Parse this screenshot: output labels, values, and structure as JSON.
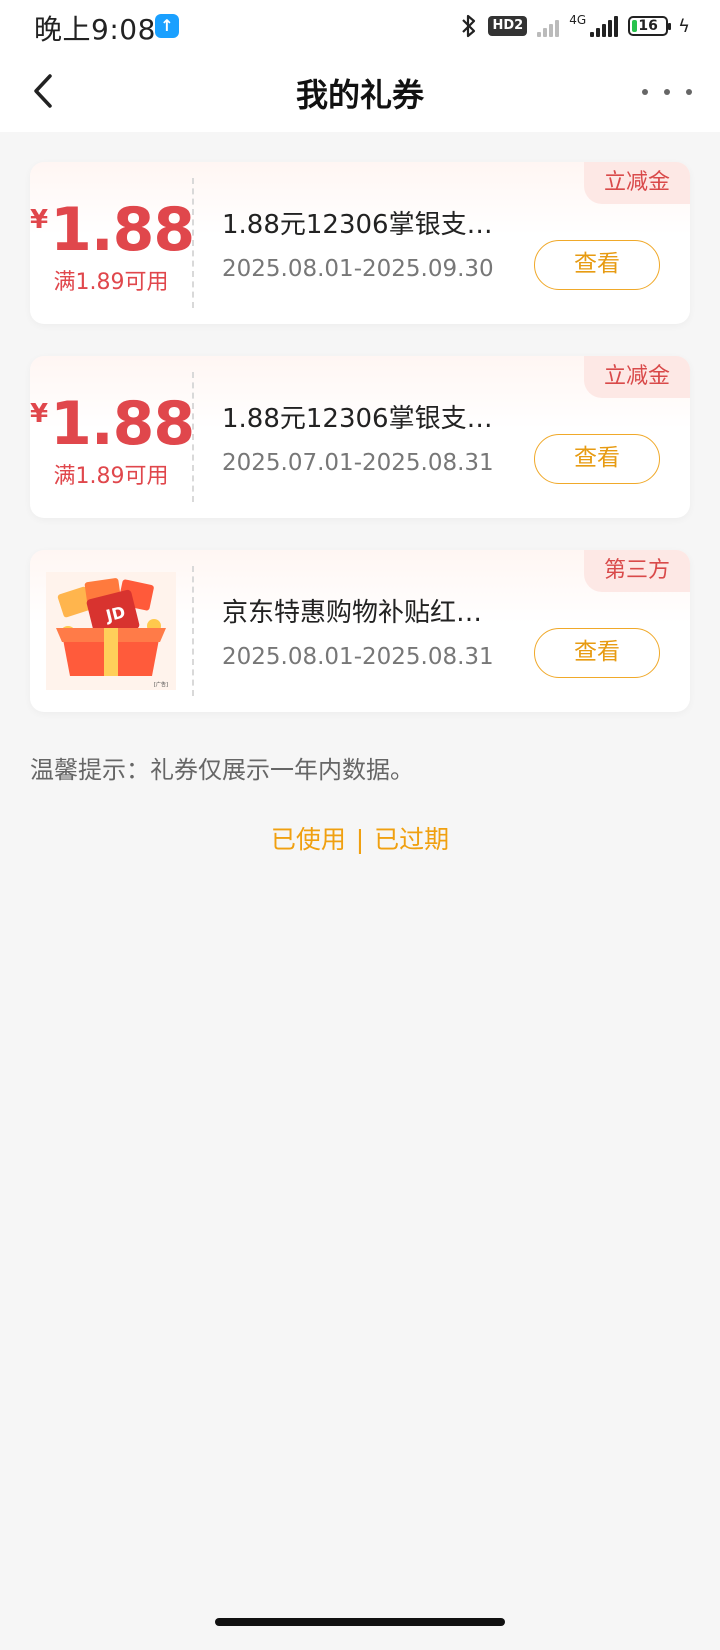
{
  "status_bar": {
    "time": "晚上9:08",
    "app_icon_glyph": "↑",
    "hd_label": "HD2",
    "network": "4G",
    "battery": "16",
    "charging_icon": "ϟ"
  },
  "header": {
    "title": "我的礼券",
    "back_icon": "chevron-left-icon",
    "more_icon": "more-dots-icon"
  },
  "coupons": [
    {
      "tag": "立减金",
      "currency": "¥",
      "amount": "1.88",
      "condition": "满1.89可用",
      "name": "1.88元12306掌银支…",
      "date_range": "2025.08.01-2025.09.30",
      "view_label": "查看"
    },
    {
      "tag": "立减金",
      "currency": "¥",
      "amount": "1.88",
      "condition": "满1.89可用",
      "name": "1.88元12306掌银支…",
      "date_range": "2025.07.01-2025.08.31",
      "view_label": "查看"
    },
    {
      "tag": "第三方",
      "image": "gift-box-image",
      "name": "京东特惠购物补贴红…",
      "date_range": "2025.08.01-2025.08.31",
      "view_label": "查看"
    }
  ],
  "tip": "温馨提示：礼券仅展示一年内数据。",
  "links": {
    "used": "已使用",
    "separator": "|",
    "expired": "已过期"
  },
  "colors": {
    "accent_red": "#e0474c",
    "accent_orange": "#f0a010",
    "background": "#f6f6f6"
  }
}
